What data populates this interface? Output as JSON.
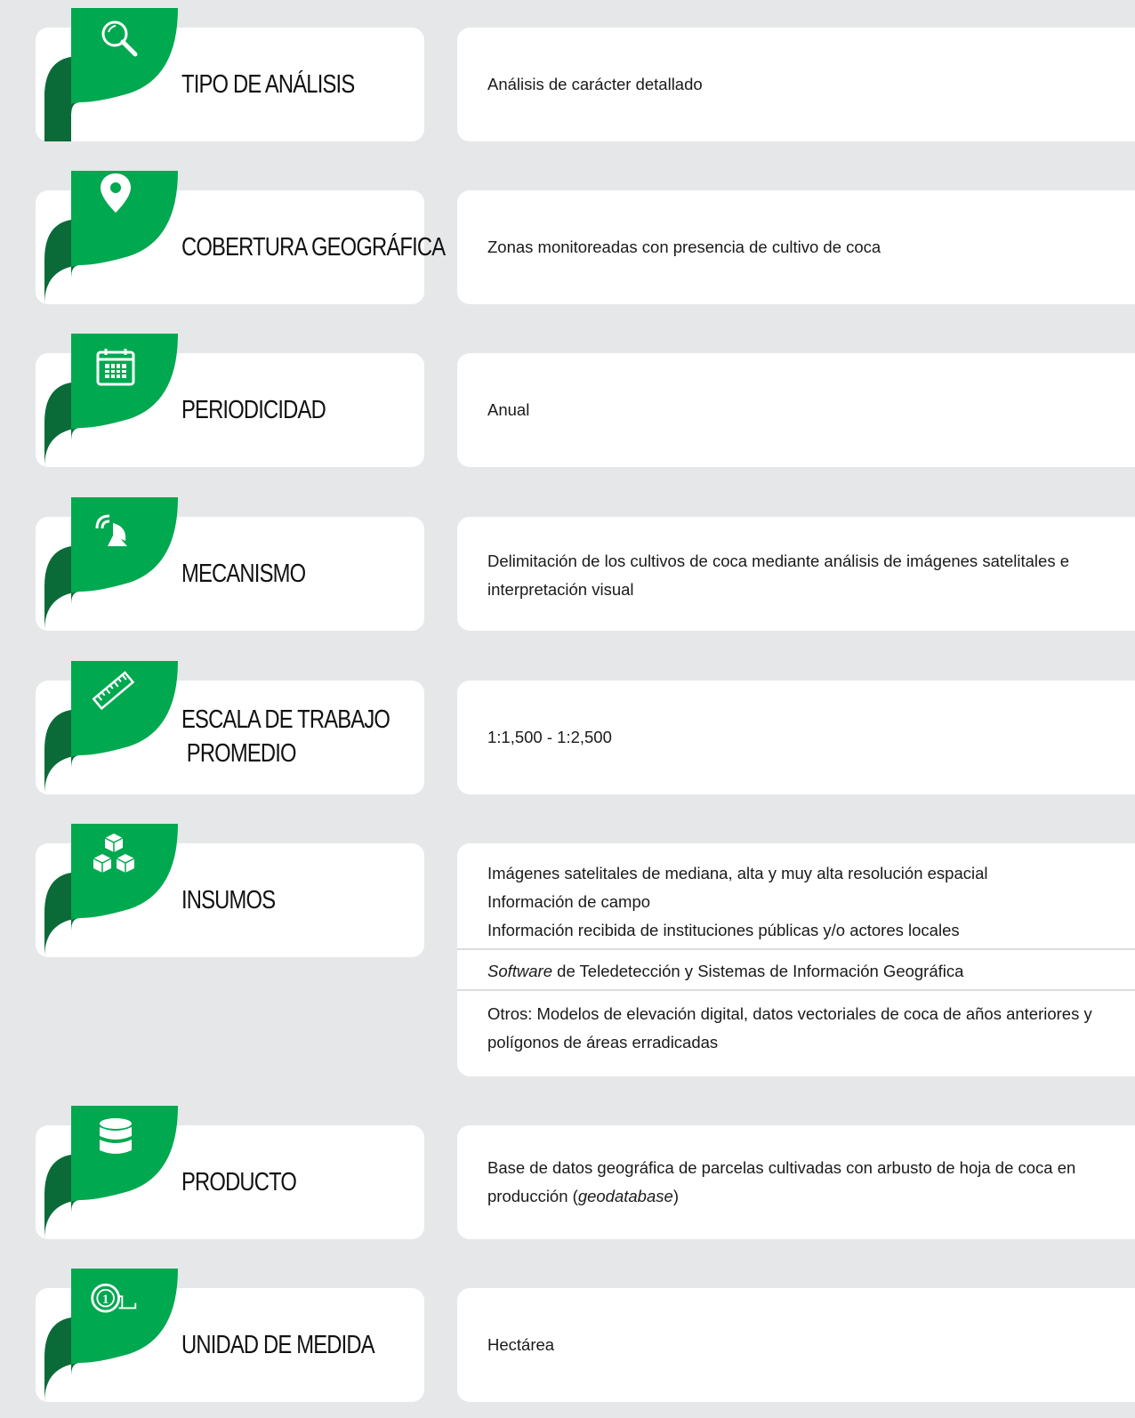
{
  "colors": {
    "green": "#00a84f",
    "dark_green": "#0b6b38",
    "card": "#ffffff",
    "background": "#e6e7e8"
  },
  "rows": [
    {
      "icon": "magnifier-icon",
      "label": "TIPO DE ANÁLISIS",
      "value": "Análisis de carácter detallado"
    },
    {
      "icon": "location-pin-icon",
      "label": "COBERTURA GEOGRÁFICA",
      "value": "Zonas monitoreadas con presencia de cultivo de coca"
    },
    {
      "icon": "calendar-icon",
      "label": "PERIODICIDAD",
      "value": "Anual"
    },
    {
      "icon": "satellite-dish-icon",
      "label": "MECANISMO",
      "value": "Delimitación de los cultivos de coca mediante análisis de imágenes satelitales e interpretación visual"
    },
    {
      "icon": "ruler-icon",
      "label_line1": "ESCALA DE TRABAJO",
      "label_line2": " PROMEDIO",
      "value": "1:1,500 - 1:2,500"
    },
    {
      "icon": "cubes-icon",
      "label": "INSUMOS",
      "value_lines": [
        "Imágenes satelitales de mediana, alta y muy alta resolución espacial",
        "Información de campo",
        "Información recibida de instituciones públicas y/o actores locales"
      ],
      "software_italic": "Software",
      "software_rest": " de Teledetección y Sistemas de Información Geográfica",
      "otros": "Otros: Modelos de elevación digital, datos vectoriales de coca de años anteriores y polígonos de áreas erradicadas"
    },
    {
      "icon": "database-icon",
      "label": "PRODUCTO",
      "value_a": "Base de datos geográfica de parcelas cultivadas con arbusto de hoja de coca en producción (",
      "value_italic": "geodatabase",
      "value_b": ")"
    },
    {
      "icon": "tape-measure-icon",
      "label": "UNIDAD DE MEDIDA",
      "value": "Hectárea"
    }
  ]
}
